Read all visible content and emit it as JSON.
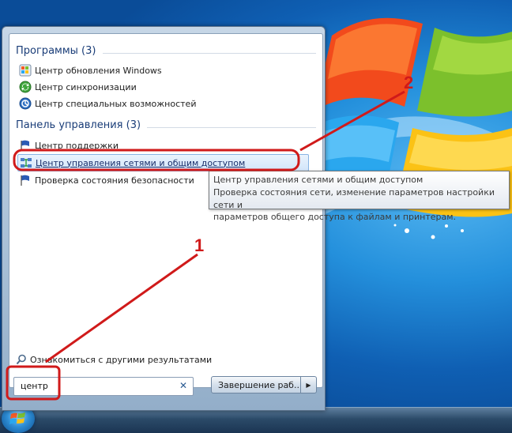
{
  "start_menu": {
    "groups": [
      {
        "title": "Программы (3)",
        "items": [
          {
            "label": "Центр обновления Windows",
            "icon": "windows-update-icon"
          },
          {
            "label": "Центр синхронизации",
            "icon": "sync-center-icon"
          },
          {
            "label": "Центр специальных возможностей",
            "icon": "ease-of-access-icon"
          }
        ]
      },
      {
        "title": "Панель управления (3)",
        "items": [
          {
            "label": "Центр поддержки",
            "icon": "action-center-flag-icon"
          },
          {
            "label": "Центр управления сетями и общим доступом",
            "icon": "network-center-icon",
            "selected": true
          },
          {
            "label": "Проверка состояния безопасности",
            "icon": "security-flag-icon"
          }
        ]
      }
    ],
    "more_results": "Ознакомиться с другими результатами",
    "search": {
      "value": "центр",
      "clear_glyph": "✕"
    },
    "shutdown_label": "Завершение раб...",
    "shutdown_arrow": "▶"
  },
  "tooltip": {
    "line1": "Центр управления сетями и общим доступом",
    "line2": "Проверка состояния сети, изменение параметров настройки сети и",
    "line3": "параметров общего доступа к файлам и принтерам."
  },
  "annotations": [
    {
      "number": "1",
      "color": "#d01a1a"
    },
    {
      "number": "2",
      "color": "#d01a1a"
    }
  ],
  "colors": {
    "accent_blue": "#1a3d78",
    "annotation_red": "#d01a1a",
    "selection_border": "#88b4e4"
  }
}
